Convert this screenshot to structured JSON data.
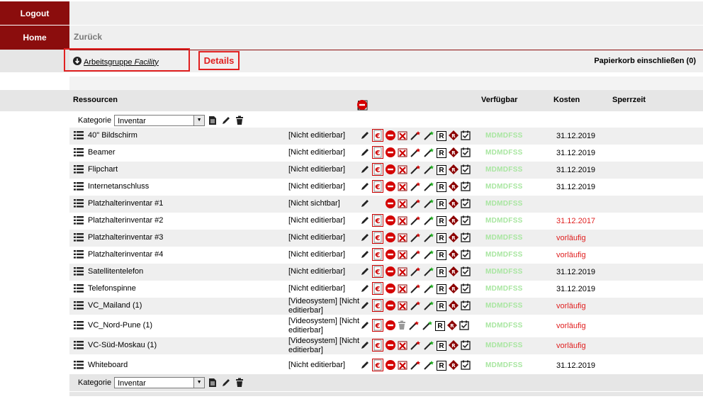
{
  "sidebar": {
    "logout": "Logout",
    "home": "Home"
  },
  "nav": {
    "back": "Zurück",
    "trash_toggle": "Papierkorb einschließen (0)"
  },
  "breadcrumb": {
    "prefix": "Arbeitsgruppe",
    "name": "Facility"
  },
  "annotation": {
    "details": "Details"
  },
  "table": {
    "headers": {
      "resources": "Ressourcen",
      "available": "Verfügbar",
      "costs": "Kosten",
      "lock_time": "Sperrzeit"
    },
    "category_label": "Kategorie",
    "category_value": "Inventar",
    "rows": [
      {
        "name": "40\" Bildschirm",
        "status": "[Nicht editierbar]",
        "cost_icon": true,
        "trash": false,
        "avail": "MDMDFSS",
        "kosten": "31.12.2019",
        "kosten_red": false
      },
      {
        "name": "Beamer",
        "status": "[Nicht editierbar]",
        "cost_icon": true,
        "trash": false,
        "avail": "MDMDFSS",
        "kosten": "31.12.2019",
        "kosten_red": false
      },
      {
        "name": "Flipchart",
        "status": "[Nicht editierbar]",
        "cost_icon": true,
        "trash": false,
        "avail": "MDMDFSS",
        "kosten": "31.12.2019",
        "kosten_red": false
      },
      {
        "name": "Internetanschluss",
        "status": "[Nicht editierbar]",
        "cost_icon": true,
        "trash": false,
        "avail": "MDMDFSS",
        "kosten": "31.12.2019",
        "kosten_red": false
      },
      {
        "name": "Platzhalterinventar #1",
        "status": "[Nicht sichtbar]",
        "cost_icon": false,
        "trash": false,
        "avail": "MDMDFSS",
        "kosten": "",
        "kosten_red": false
      },
      {
        "name": "Platzhalterinventar #2",
        "status": "[Nicht editierbar]",
        "cost_icon": true,
        "trash": false,
        "avail": "MDMDFSS",
        "kosten": "31.12.2017",
        "kosten_red": true
      },
      {
        "name": "Platzhalterinventar #3",
        "status": "[Nicht editierbar]",
        "cost_icon": true,
        "trash": false,
        "avail": "MDMDFSS",
        "kosten": "vorläufig",
        "kosten_red": true
      },
      {
        "name": "Platzhalterinventar #4",
        "status": "[Nicht editierbar]",
        "cost_icon": true,
        "trash": false,
        "avail": "MDMDFSS",
        "kosten": "vorläufig",
        "kosten_red": true
      },
      {
        "name": "Satellitentelefon",
        "status": "[Nicht editierbar]",
        "cost_icon": true,
        "trash": false,
        "avail": "MDMDFSS",
        "kosten": "31.12.2019",
        "kosten_red": false
      },
      {
        "name": "Telefonspinne",
        "status": "[Nicht editierbar]",
        "cost_icon": true,
        "trash": false,
        "avail": "MDMDFSS",
        "kosten": "31.12.2019",
        "kosten_red": false
      },
      {
        "name": "VC_Mailand (1)",
        "status": "[Videosystem] [Nicht editierbar]",
        "cost_icon": true,
        "trash": false,
        "avail": "MDMDFSS",
        "kosten": "vorläufig",
        "kosten_red": true
      },
      {
        "name": "VC_Nord-Pune (1)",
        "status": "[Videosystem] [Nicht editierbar]",
        "cost_icon": true,
        "trash": true,
        "avail": "MDMDFSS",
        "kosten": "vorläufig",
        "kosten_red": true
      },
      {
        "name": "VC-Süd-Moskau (1)",
        "status": "[Videosystem] [Nicht editierbar]",
        "cost_icon": true,
        "trash": false,
        "avail": "MDMDFSS",
        "kosten": "vorläufig",
        "kosten_red": true
      },
      {
        "name": "Whiteboard",
        "status": "[Nicht editierbar]",
        "cost_icon": true,
        "trash": false,
        "avail": "MDMDFSS",
        "kosten": "31.12.2019",
        "kosten_red": false
      }
    ]
  }
}
